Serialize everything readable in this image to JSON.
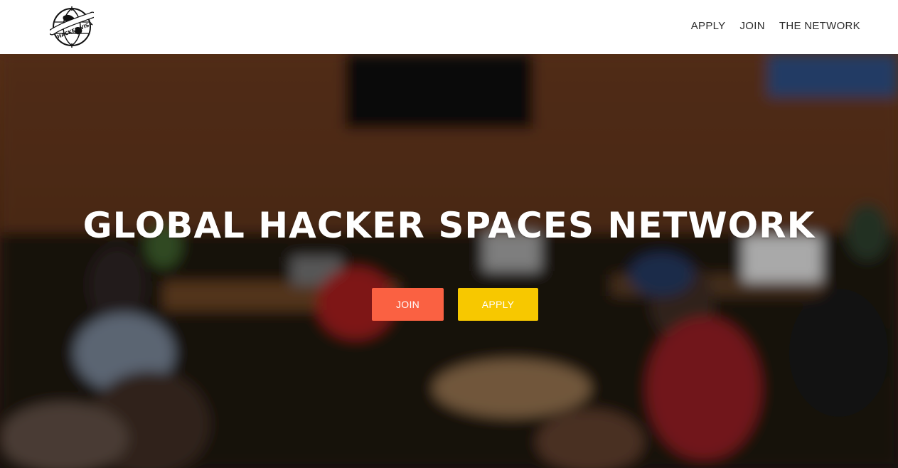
{
  "logo": {
    "text": "HACKER VISA",
    "icon": "globe-logo-icon"
  },
  "nav": {
    "links": [
      {
        "label": "APPLY"
      },
      {
        "label": "JOIN"
      },
      {
        "label": "THE NETWORK"
      }
    ]
  },
  "hero": {
    "title": "GLOBAL HACKER SPACES NETWORK",
    "join_label": "JOIN",
    "apply_label": "APPLY",
    "background": "blurred-photo-of-people-working-at-laptops"
  },
  "colors": {
    "join_button": "#fa6142",
    "apply_button": "#f7c800",
    "nav_text": "#2b2b2b",
    "hero_text": "#ffffff"
  }
}
